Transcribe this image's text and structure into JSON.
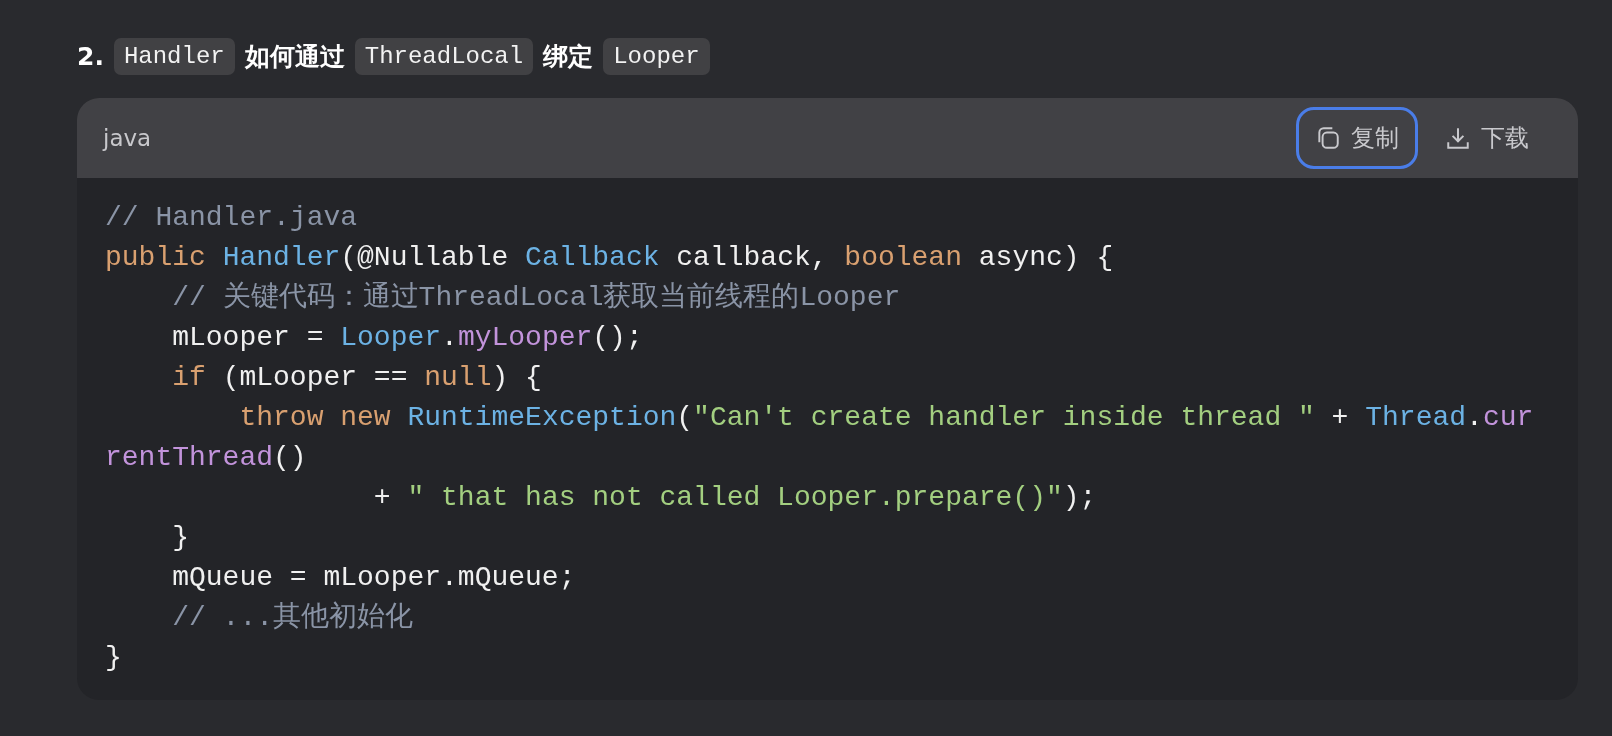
{
  "heading": {
    "number": "2.",
    "parts": [
      {
        "kind": "code",
        "text": "Handler"
      },
      {
        "kind": "text",
        "text": "如何通过"
      },
      {
        "kind": "code",
        "text": "ThreadLocal"
      },
      {
        "kind": "text",
        "text": "绑定"
      },
      {
        "kind": "code",
        "text": "Looper"
      }
    ]
  },
  "code_block": {
    "language": "java",
    "buttons": [
      {
        "kind": "copy",
        "label": "复制",
        "focused": true
      },
      {
        "kind": "download",
        "label": "下载",
        "focused": false
      }
    ],
    "lines": [
      [
        {
          "kind": "comment",
          "text": "// Handler.java"
        }
      ],
      [
        {
          "kind": "keyword",
          "text": "public "
        },
        {
          "kind": "type",
          "text": "Handler"
        },
        {
          "kind": "plain",
          "text": "(@Nullable "
        },
        {
          "kind": "type",
          "text": "Callback"
        },
        {
          "kind": "plain",
          "text": " callback, "
        },
        {
          "kind": "keyword",
          "text": "boolean"
        },
        {
          "kind": "plain",
          "text": " async) {"
        }
      ],
      [
        {
          "kind": "comment",
          "text": "    // 关键代码：通过ThreadLocal获取当前线程的Looper"
        }
      ],
      [
        {
          "kind": "plain",
          "text": "    mLooper = "
        },
        {
          "kind": "type",
          "text": "Looper"
        },
        {
          "kind": "plain",
          "text": "."
        },
        {
          "kind": "method",
          "text": "myLooper"
        },
        {
          "kind": "plain",
          "text": "();"
        }
      ],
      [
        {
          "kind": "keyword",
          "text": "    if"
        },
        {
          "kind": "plain",
          "text": " (mLooper == "
        },
        {
          "kind": "keyword",
          "text": "null"
        },
        {
          "kind": "plain",
          "text": ") {"
        }
      ],
      [
        {
          "kind": "keyword",
          "text": "        throw new "
        },
        {
          "kind": "type",
          "text": "RuntimeException"
        },
        {
          "kind": "plain",
          "text": "("
        },
        {
          "kind": "string",
          "text": "\"Can't create handler inside thread \""
        },
        {
          "kind": "plain",
          "text": " + "
        },
        {
          "kind": "type",
          "text": "Thread"
        },
        {
          "kind": "plain",
          "text": "."
        },
        {
          "kind": "method",
          "text": "cur"
        }
      ],
      [
        {
          "kind": "method",
          "text": "rentThread"
        },
        {
          "kind": "plain",
          "text": "()"
        }
      ],
      [
        {
          "kind": "plain",
          "text": "                + "
        },
        {
          "kind": "string",
          "text": "\" that has not called Looper.prepare()\""
        },
        {
          "kind": "plain",
          "text": ");"
        }
      ],
      [
        {
          "kind": "plain",
          "text": "    }"
        }
      ],
      [
        {
          "kind": "plain",
          "text": "    mQueue = mLooper.mQueue;"
        }
      ],
      [
        {
          "kind": "comment",
          "text": "    // ...其他初始化"
        }
      ],
      [
        {
          "kind": "plain",
          "text": "}"
        }
      ]
    ]
  }
}
